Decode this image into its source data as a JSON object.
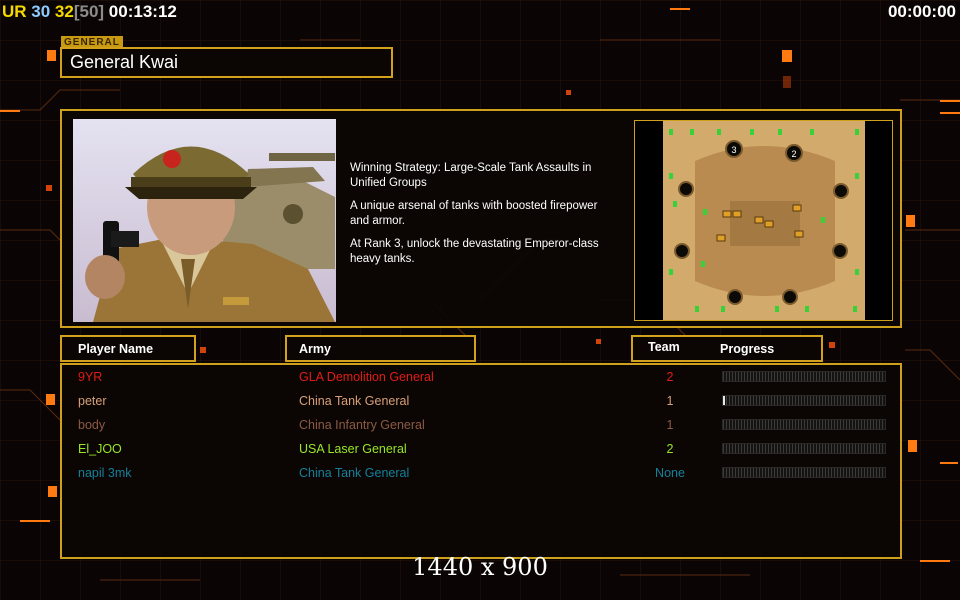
{
  "hud": {
    "stats": [
      {
        "text": "UR",
        "color": "#f5d800"
      },
      {
        "text": " 30",
        "color": "#8ecbff"
      },
      {
        "text": " 32",
        "color": "#f5d800"
      },
      {
        "text": "[50]",
        "color": "#8c8c8c"
      },
      {
        "text": " 00:13:12",
        "color": "#ffffff"
      }
    ],
    "game_timer": "00:00:00"
  },
  "general": {
    "tab_label": "GENERAL",
    "name": "General Kwai",
    "description": [
      "Winning Strategy: Large-Scale Tank Assaults in\n Unified Groups",
      "A unique arsenal of tanks with boosted firepower\n and armor.",
      "At Rank 3, unlock the devastating Emperor-class\n heavy tanks."
    ]
  },
  "minimap": {
    "start_positions": [
      "3",
      "2"
    ]
  },
  "columns": {
    "player_name": "Player Name",
    "army": "Army",
    "team": "Team",
    "progress": "Progress"
  },
  "players": [
    {
      "name": "9YR",
      "army": "GLA Demolition General",
      "team": "2",
      "progress": 0.0,
      "color": "#e01c16",
      "team_color": "#e01c16"
    },
    {
      "name": "peter",
      "army": "China Tank General",
      "team": "1",
      "progress": 0.01,
      "color": "#d7a079",
      "team_color": "#d7a079"
    },
    {
      "name": "body",
      "army": "China Infantry General",
      "team": "1",
      "progress": 0.0,
      "color": "#8c5a44",
      "team_color": "#8c5a44"
    },
    {
      "name": "El_JOO",
      "army": "USA Laser General",
      "team": "2",
      "progress": 0.0,
      "color": "#98e62a",
      "team_color": "#98e62a"
    },
    {
      "name": "napil 3mk",
      "army": "China Tank General",
      "team": "None",
      "progress": 0.0,
      "color": "#14809a",
      "team_color": "#14809a"
    }
  ],
  "resolution_label": "1440 x 900",
  "colors": {
    "frame_gold": "#cfa01c",
    "grid_orange": "#b5520a"
  }
}
